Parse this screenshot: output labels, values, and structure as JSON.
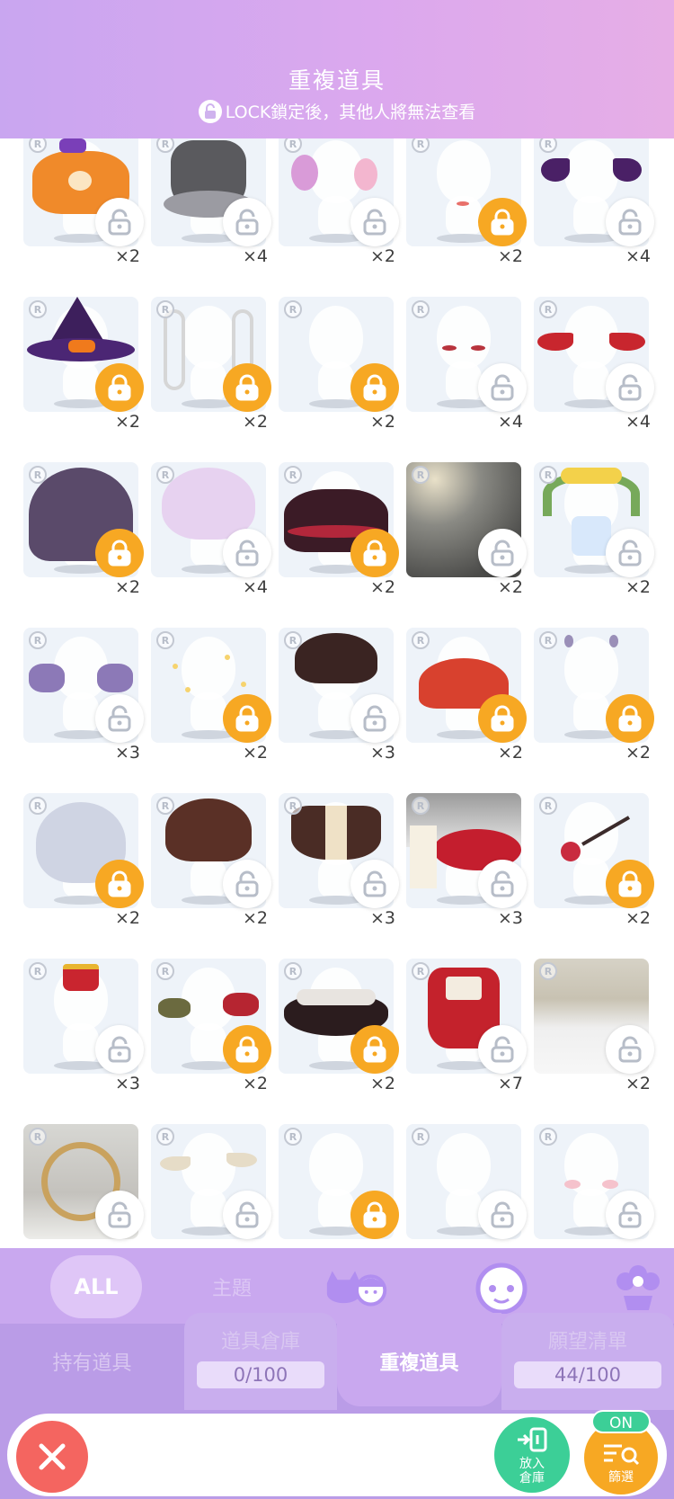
{
  "header": {
    "title": "重複道具",
    "subtitle": "LOCK鎖定後，其他人將無法查看",
    "lock_icon": "lock-icon",
    "gradient_start": "#c9a6f0",
    "gradient_end": "#e6aee6"
  },
  "colors": {
    "accent_locked": "#f7a823",
    "tab_purple": "#c9a8ef",
    "close_red": "#f46560",
    "store_green": "#3ccf97"
  },
  "items": [
    {
      "rarity": "R",
      "qty": "×2",
      "locked": false,
      "icon": "halloween-skirt-icon"
    },
    {
      "rarity": "R",
      "qty": "×4",
      "locked": false,
      "icon": "black-dress-icon"
    },
    {
      "rarity": "R",
      "qty": "×2",
      "locked": false,
      "icon": "ghost-flames-icon"
    },
    {
      "rarity": "R",
      "qty": "×2",
      "locked": true,
      "icon": "lip-makeup-icon"
    },
    {
      "rarity": "R",
      "qty": "×4",
      "locked": false,
      "icon": "bat-wings-icon"
    },
    {
      "rarity": "R",
      "qty": "×2",
      "locked": true,
      "icon": "witch-hat-icon"
    },
    {
      "rarity": "R",
      "qty": "×2",
      "locked": true,
      "icon": "silver-twintails-icon"
    },
    {
      "rarity": "R",
      "qty": "×2",
      "locked": true,
      "icon": "blank-mannequin-icon"
    },
    {
      "rarity": "R",
      "qty": "×4",
      "locked": false,
      "icon": "red-eyes-icon"
    },
    {
      "rarity": "R",
      "qty": "×4",
      "locked": false,
      "icon": "red-wings-icon"
    },
    {
      "rarity": "R",
      "qty": "×2",
      "locked": true,
      "icon": "purple-veil-icon"
    },
    {
      "rarity": "R",
      "qty": "×4",
      "locked": false,
      "icon": "pink-short-hair-icon"
    },
    {
      "rarity": "R",
      "qty": "×2",
      "locked": true,
      "icon": "red-black-skirt-icon"
    },
    {
      "rarity": "R",
      "qty": "×2",
      "locked": false,
      "icon": "light-background-icon"
    },
    {
      "rarity": "R",
      "qty": "×2",
      "locked": false,
      "icon": "flower-arch-icon"
    },
    {
      "rarity": "R",
      "qty": "×3",
      "locked": false,
      "icon": "purple-bows-icon"
    },
    {
      "rarity": "R",
      "qty": "×2",
      "locked": true,
      "icon": "sparkles-icon"
    },
    {
      "rarity": "R",
      "qty": "×3",
      "locked": false,
      "icon": "dark-hair-icon"
    },
    {
      "rarity": "R",
      "qty": "×2",
      "locked": true,
      "icon": "red-fan-dress-icon"
    },
    {
      "rarity": "R",
      "qty": "×2",
      "locked": true,
      "icon": "ear-accessory-icon"
    },
    {
      "rarity": "R",
      "qty": "×2",
      "locked": true,
      "icon": "silver-bob-hair-icon"
    },
    {
      "rarity": "R",
      "qty": "×2",
      "locked": false,
      "icon": "brown-hair-icon"
    },
    {
      "rarity": "R",
      "qty": "×3",
      "locked": false,
      "icon": "brown-cape-icon"
    },
    {
      "rarity": "R",
      "qty": "×3",
      "locked": false,
      "icon": "rose-frame-icon"
    },
    {
      "rarity": "R",
      "qty": "×2",
      "locked": true,
      "icon": "heart-wand-icon"
    },
    {
      "rarity": "R",
      "qty": "×3",
      "locked": false,
      "icon": "crown-icon"
    },
    {
      "rarity": "R",
      "qty": "×2",
      "locked": true,
      "icon": "ribbon-bows-icon"
    },
    {
      "rarity": "R",
      "qty": "×2",
      "locked": true,
      "icon": "royal-collar-icon"
    },
    {
      "rarity": "R",
      "qty": "×7",
      "locked": false,
      "icon": "queen-outfit-icon"
    },
    {
      "rarity": "R",
      "qty": "×2",
      "locked": false,
      "icon": "snow-castle-icon"
    },
    {
      "rarity": "R",
      "qty": "",
      "locked": false,
      "icon": "gold-ring-frame-icon"
    },
    {
      "rarity": "R",
      "qty": "",
      "locked": false,
      "icon": "feather-wings-icon"
    },
    {
      "rarity": "R",
      "qty": "",
      "locked": true,
      "icon": "blank-mannequin-icon"
    },
    {
      "rarity": "R",
      "qty": "",
      "locked": false,
      "icon": "blank-mannequin-icon"
    },
    {
      "rarity": "R",
      "qty": "",
      "locked": false,
      "icon": "blush-icon"
    }
  ],
  "category_tabs": {
    "all": "ALL",
    "theme": "主題",
    "icons": [
      "pets-icon",
      "face-icon",
      "plant-icon"
    ]
  },
  "sub_tabs": {
    "owned": "持有道具",
    "storage": "道具倉庫",
    "storage_count": "0/100",
    "duplicate": "重複道具",
    "wishlist": "願望清單",
    "wishlist_count": "44/100"
  },
  "bottom_bar": {
    "close_icon": "close-icon",
    "store_label_line1": "放入",
    "store_label_line2": "倉庫",
    "filter_label": "篩選",
    "filter_status": "ON"
  }
}
